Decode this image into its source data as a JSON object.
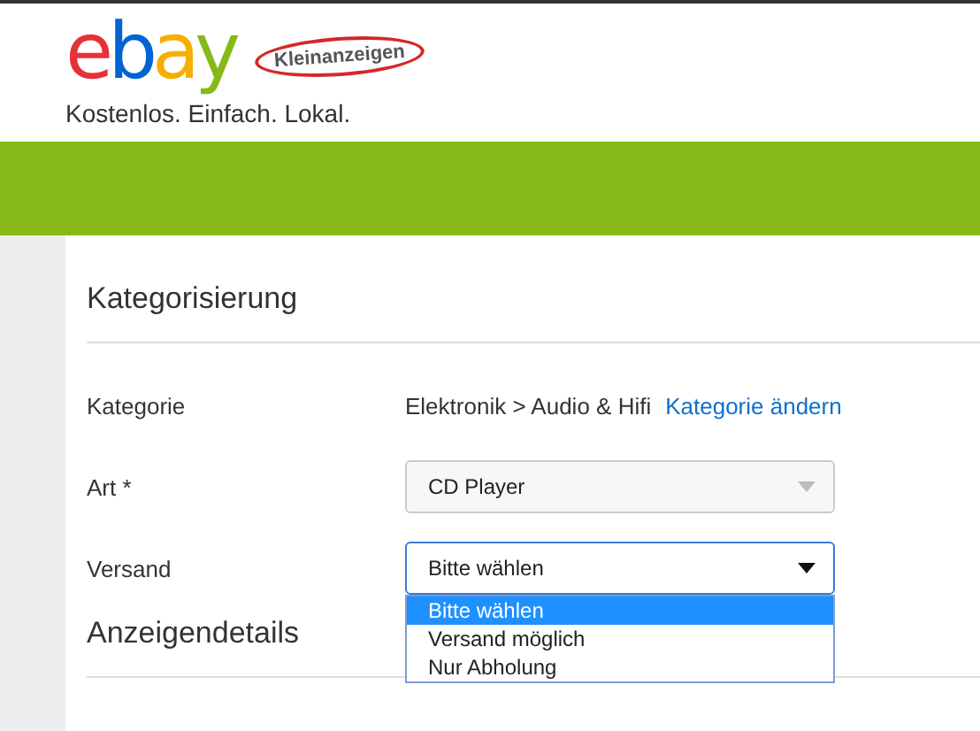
{
  "header": {
    "logo_letters": [
      {
        "text": "e",
        "color": "#e53238"
      },
      {
        "text": "b",
        "color": "#0064d2"
      },
      {
        "text": "a",
        "color": "#f5af02"
      },
      {
        "text": "y",
        "color": "#86b817"
      }
    ],
    "badge": "Kleinanzeigen",
    "tagline": "Kostenlos. Einfach. Lokal."
  },
  "sections": [
    {
      "title": "Kategorisierung",
      "rows": [
        {
          "kind": "text",
          "label": "Kategorie",
          "value": "Elektronik > Audio & Hifi",
          "link": "Kategorie ändern"
        },
        {
          "kind": "select",
          "label": "Art *",
          "value": "CD Player",
          "focused": false
        },
        {
          "kind": "select",
          "label": "Versand",
          "value": "Bitte wählen",
          "focused": true,
          "options": [
            {
              "label": "Bitte wählen",
              "selected": true
            },
            {
              "label": "Versand möglich",
              "selected": false
            },
            {
              "label": "Nur Abholung",
              "selected": false
            }
          ]
        }
      ]
    },
    {
      "title": "Anzeigendetails"
    }
  ]
}
